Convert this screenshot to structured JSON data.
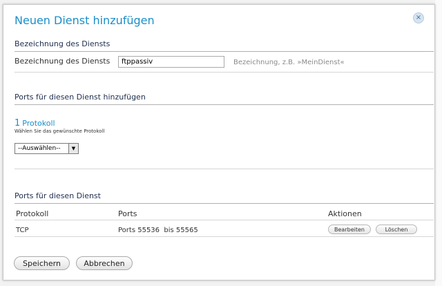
{
  "dialog": {
    "title": "Neuen Dienst hinzufügen",
    "close_symbol": "×"
  },
  "name_section": {
    "heading": "Bezeichnung des Diensts",
    "field_label": "Bezeichnung des Diensts",
    "field_value": "ftppassiv",
    "hint": "Bezeichnung, z.B. »MeinDienst«"
  },
  "ports_add_section": {
    "heading": "Ports für diesen Dienst hinzufügen",
    "step_number": "1",
    "step_label": "Protokoll",
    "step_description": "Wählen Sie das gewünschte Protokoll",
    "select_value": "--Auswählen--"
  },
  "ports_list_section": {
    "heading": "Ports für diesen Dienst",
    "columns": [
      "Protokoll",
      "Ports",
      "Aktionen"
    ],
    "rows": [
      {
        "protocol": "TCP",
        "ports": "Ports 55536  bis 55565",
        "edit_label": "Bearbeiten",
        "delete_label": "Löschen"
      }
    ]
  },
  "footer": {
    "save_label": "Speichern",
    "cancel_label": "Abbrechen"
  }
}
